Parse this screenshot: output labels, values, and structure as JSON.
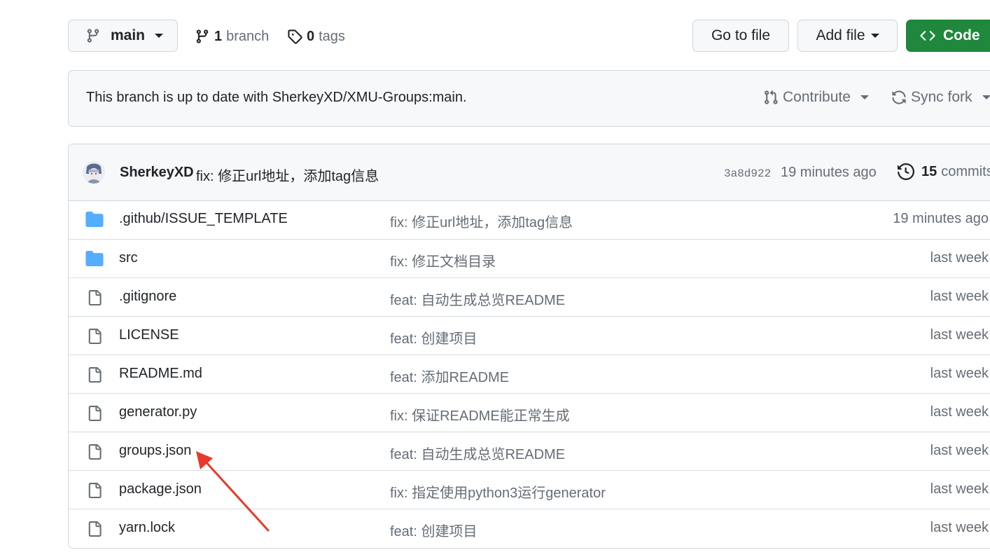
{
  "toolbar": {
    "branch_name": "main",
    "branches_count": "1",
    "branches_label": "branch",
    "tags_count": "0",
    "tags_label": "tags",
    "go_to_file": "Go to file",
    "add_file": "Add file",
    "code": "Code"
  },
  "sync": {
    "message": "This branch is up to date with SherkeyXD/XMU-Groups:main.",
    "contribute": "Contribute",
    "sync_fork": "Sync fork"
  },
  "latest_commit": {
    "author": "SherkeyXD",
    "message": "fix: 修正url地址，添加tag信息",
    "sha": "3a8d922",
    "time": "19 minutes ago",
    "commits_count": "15",
    "commits_label": "commits"
  },
  "files": [
    {
      "name": ".github/ISSUE_TEMPLATE",
      "type": "folder",
      "message": "fix: 修正url地址，添加tag信息",
      "time": "19 minutes ago"
    },
    {
      "name": "src",
      "type": "folder",
      "message": "fix: 修正文档目录",
      "time": "last week"
    },
    {
      "name": ".gitignore",
      "type": "file",
      "message": "feat: 自动生成总览README",
      "time": "last week"
    },
    {
      "name": "LICENSE",
      "type": "file",
      "message": "feat: 创建项目",
      "time": "last week"
    },
    {
      "name": "README.md",
      "type": "file",
      "message": "feat: 添加README",
      "time": "last week"
    },
    {
      "name": "generator.py",
      "type": "file",
      "message": "fix: 保证README能正常生成",
      "time": "last week"
    },
    {
      "name": "groups.json",
      "type": "file",
      "message": "feat: 自动生成总览README",
      "time": "last week"
    },
    {
      "name": "package.json",
      "type": "file",
      "message": "fix: 指定使用python3运行generator",
      "time": "last week"
    },
    {
      "name": "yarn.lock",
      "type": "file",
      "message": "feat: 创建项目",
      "time": "last week"
    }
  ],
  "colors": {
    "code_button": "#1f883d",
    "folder_icon": "#54aeff",
    "annotation_arrow": "#e8392c"
  }
}
